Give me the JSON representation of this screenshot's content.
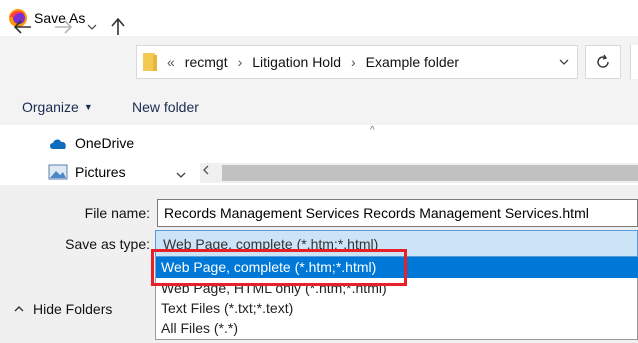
{
  "window": {
    "title": "Save As",
    "logo_icon": "firefox-icon"
  },
  "nav": {
    "back_icon": "arrow-left-icon",
    "forward_icon": "arrow-right-icon",
    "recent_icon": "chevron-down-icon",
    "up_icon": "arrow-up-icon",
    "refresh_icon": "refresh-icon"
  },
  "address": {
    "overflow": "«",
    "crumbs": [
      "recmgt",
      "Litigation Hold",
      "Example folder"
    ],
    "separator": "›"
  },
  "toolbar": {
    "organize_label": "Organize",
    "new_folder_label": "New folder"
  },
  "nav_pane": {
    "items": [
      {
        "label": "OneDrive",
        "icon": "cloud-icon"
      },
      {
        "label": "Pictures",
        "icon": "pictures-icon"
      }
    ]
  },
  "form": {
    "file_name_label": "File name:",
    "file_name_value": "Records Management Services   Records Management Services.html",
    "save_type_label": "Save as type:",
    "save_type_value": "Web Page, complete (*.htm;*.html)",
    "options": [
      "Web Page, complete (*.htm;*.html)",
      "Web Page, HTML only (*.htm;*.html)",
      "Text Files (*.txt;*.text)",
      "All Files (*.*)"
    ]
  },
  "footer": {
    "hide_folders_label": "Hide Folders"
  },
  "colors": {
    "selection": "#0078d7",
    "highlight_box": "#e8202a",
    "select_bg": "#cce4f7"
  }
}
